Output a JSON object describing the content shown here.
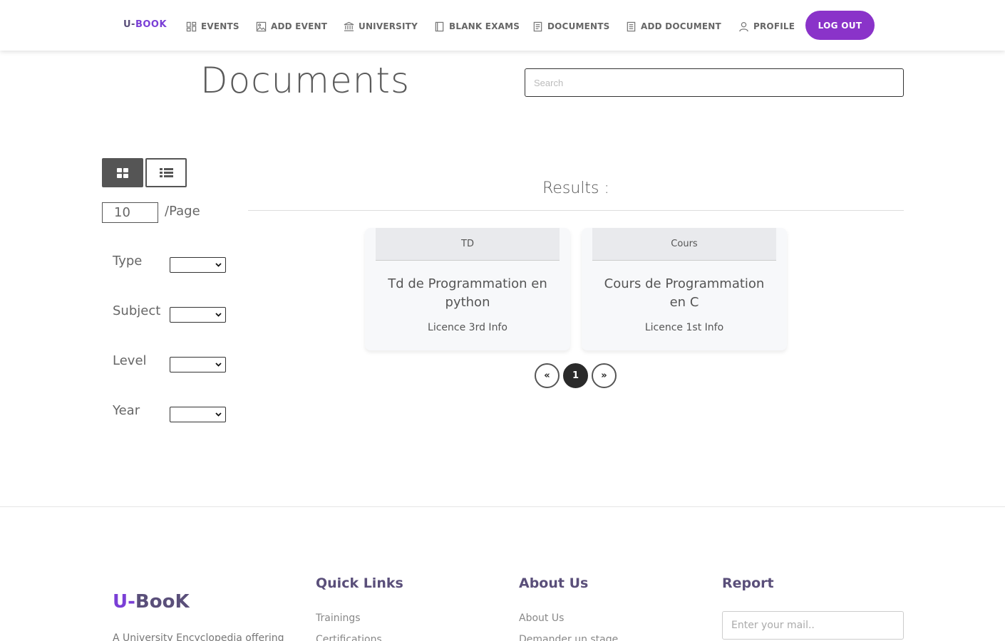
{
  "nav": {
    "brand_u": "U-",
    "brand_b": "BOOK",
    "items": [
      {
        "label": "EVENTS",
        "icon": "grid-icon"
      },
      {
        "label": "ADD EVENT",
        "icon": "image-icon"
      },
      {
        "label": "UNIVERSITY",
        "icon": "bank-icon"
      },
      {
        "label": "BLANK EXAMS",
        "icon": "notebook-icon"
      },
      {
        "label": "DOCUMENTS",
        "icon": "document-icon"
      },
      {
        "label": "ADD DOCUMENT",
        "icon": "document-add-icon"
      },
      {
        "label": "PROFILE",
        "icon": "user-icon"
      }
    ],
    "logout": "LOG OUT"
  },
  "page": {
    "title": "Documents",
    "search_placeholder": "Search"
  },
  "controls": {
    "per_page_value": "10",
    "per_page_label": "/Page",
    "filters": [
      {
        "label": "Type",
        "value": ""
      },
      {
        "label": "Subject",
        "value": ""
      },
      {
        "label": "Level",
        "value": ""
      },
      {
        "label": "Year",
        "value": ""
      }
    ]
  },
  "results": {
    "title": "Results :",
    "cards": [
      {
        "type": "TD",
        "title": "Td de Programmation en python",
        "level": "Licence 3rd Info"
      },
      {
        "type": "Cours",
        "title": "Cours de Programmation en C",
        "level": "Licence 1st Info"
      }
    ],
    "pagination": {
      "prev": "«",
      "current": "1",
      "next": "»"
    }
  },
  "footer": {
    "brand_u": "U-",
    "brand_rest": "BooK",
    "description": "A University Encyclopedia offering",
    "quick_links_title": "Quick Links",
    "quick_links": [
      "Trainings",
      "Certifications"
    ],
    "about_title": "About Us",
    "about_links": [
      "About Us",
      "Demander un stage"
    ],
    "report_title": "Report",
    "report_placeholder": "Enter your mail.."
  }
}
